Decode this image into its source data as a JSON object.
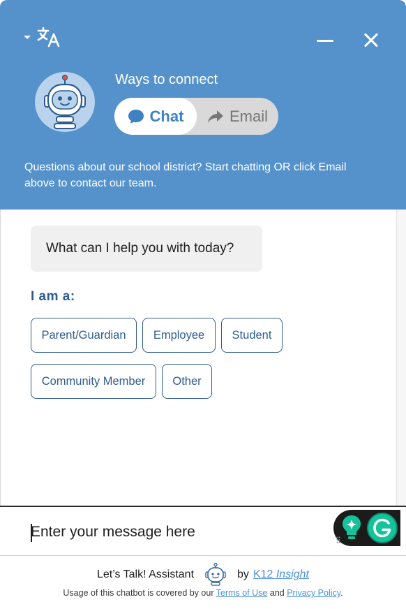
{
  "header": {
    "title": "Ways to connect",
    "chat_label": "Chat",
    "email_label": "Email",
    "description": "Questions about our school district? Start chatting OR click Email above to contact our team."
  },
  "conversation": {
    "bot_message": "What can I help you with today?",
    "prompt_label": "I am a:",
    "options": [
      "Parent/Guardian",
      "Employee",
      "Student",
      "Community Member",
      "Other"
    ]
  },
  "input": {
    "placeholder": "Enter your message here"
  },
  "footer": {
    "assistant_name": "Let’s Talk! Assistant",
    "by": "by",
    "brand_k12": "K12",
    "brand_insight": "Insight",
    "legal_prefix": "Usage of this chatbot is covered by our",
    "terms_label": "Terms of Use",
    "and": "and",
    "privacy_label": "Privacy Policy",
    "period": "."
  },
  "colors": {
    "header_bg": "#5592cc",
    "accent_blue": "#3f82c2",
    "option_border": "#2e5c8f",
    "link": "#4a90d9",
    "grammarly": "#15c39a"
  },
  "icons": {
    "language": "translate-icon",
    "minimize": "minimize-icon",
    "close": "close-icon",
    "chat": "chat-bubble-icon",
    "email": "share-arrow-icon",
    "avatar": "robot-icon"
  }
}
